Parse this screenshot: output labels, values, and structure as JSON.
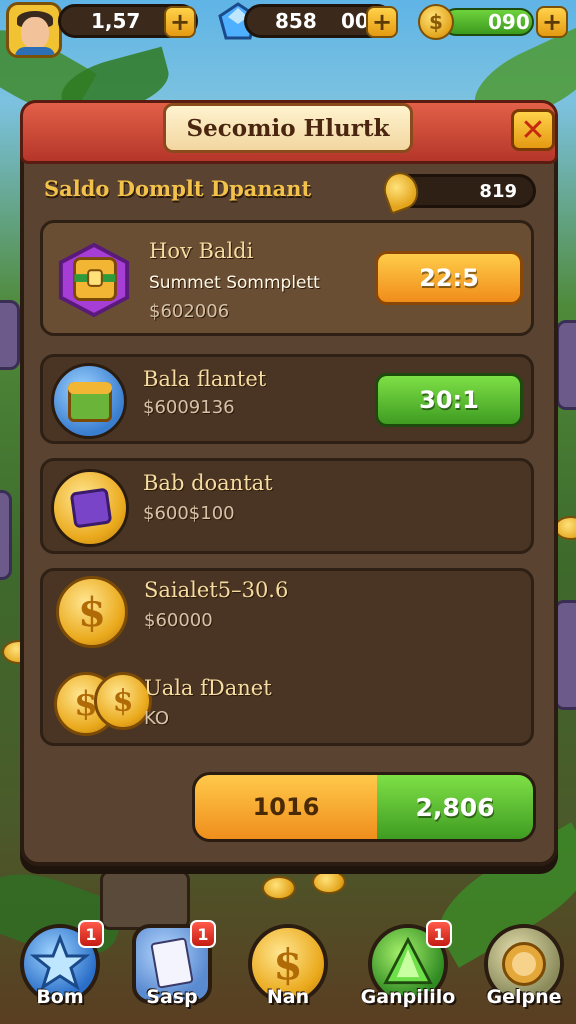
{
  "hud": {
    "level": "1,57",
    "gems": "858",
    "gems_extra": "00",
    "coins": "090",
    "plus": "+"
  },
  "modal": {
    "title": "Secomio Hlurtk",
    "close": "✕",
    "balance_label": "Saldo Domplt Dpanant",
    "balance_value": "819"
  },
  "rows": [
    {
      "title": "Hov Baldi",
      "subtitle": "Summet Sommplett",
      "price": "$602006",
      "button": "22:5",
      "button_color": "orange"
    },
    {
      "title": "Bala flantet",
      "price": "$6009136",
      "button": "30:1",
      "button_color": "green"
    },
    {
      "title": "Bab doantat",
      "price": "$600$100"
    },
    {
      "title": "Saialet5–30.6",
      "price": "$60000"
    },
    {
      "title": "Uala fDanet",
      "price": "KO"
    }
  ],
  "totals": {
    "left": "1016",
    "right": "2,806"
  },
  "nav": [
    {
      "label": "Bom",
      "badge": "1",
      "icon": "star-icon"
    },
    {
      "label": "Sasp",
      "badge": "1",
      "icon": "cards-icon"
    },
    {
      "label": "Nan",
      "badge": "",
      "icon": "coin-icon"
    },
    {
      "label": "Ganpililo",
      "badge": "1",
      "icon": "green-gem-icon"
    },
    {
      "label": "Gelpne",
      "badge": "",
      "icon": "lion-icon"
    }
  ],
  "colors": {
    "header_red": "#c23e2e",
    "panel_brown": "#5a4330",
    "button_orange": "#f5a42a",
    "button_green": "#5cc02e",
    "gold_text": "#f3c24a"
  }
}
